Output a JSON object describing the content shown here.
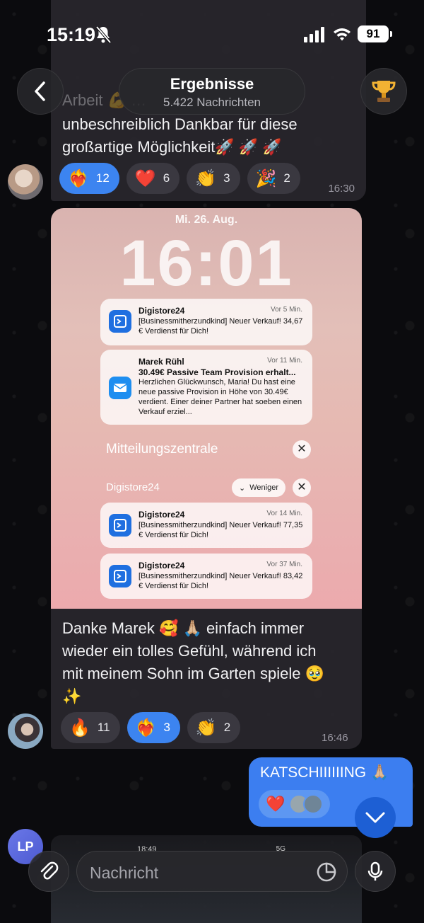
{
  "status_bar": {
    "time": "15:19",
    "battery": "91"
  },
  "header": {
    "title": "Ergebnisse",
    "subtitle": "5.422 Nachrichten"
  },
  "messages": [
    {
      "text_lines": [
        "Arbeit 💪 …",
        "unbeschreiblich Dankbar für diese",
        "großartige Möglichkeit🚀 🚀 🚀"
      ],
      "reactions": [
        {
          "emoji": "❤️‍🔥",
          "count": "12",
          "active": true
        },
        {
          "emoji": "❤️",
          "count": "6",
          "active": false
        },
        {
          "emoji": "👏",
          "count": "3",
          "active": false
        },
        {
          "emoji": "🎉",
          "count": "2",
          "active": false
        }
      ],
      "time": "16:30"
    },
    {
      "screenshot": {
        "date": "Mi. 26. Aug.",
        "clock": "16:01",
        "notifications": [
          {
            "app": "Digistore24",
            "when": "Vor 5 Min.",
            "title": "",
            "body": "[Businessmitherzundkind] Neuer Verkauf! 34,67 € Verdienst für Dich!"
          },
          {
            "app": "Marek Rühl",
            "when": "Vor 11 Min.",
            "title": "30.49€ Passive Team Provision erhalt...",
            "body": "Herzlichen Glückwunsch, Maria! Du hast eine neue passive Provision in Höhe von 30.49€ verdient. Einer deiner Partner hat soeben einen Verkauf erziel..."
          },
          {
            "app": "Digistore24",
            "when": "Vor 14 Min.",
            "title": "",
            "body": "[Businessmitherzundkind] Neuer Verkauf! 77,35 € Verdienst für Dich!"
          },
          {
            "app": "Digistore24",
            "when": "Vor 37 Min.",
            "title": "",
            "body": "[Businessmitherzundkind] Neuer Verkauf! 83,42 € Verdienst für Dich!"
          }
        ],
        "notification_center": "Mitteilungszentrale",
        "group_label": "Digistore24",
        "less_label": "Weniger"
      },
      "text_lines": [
        "Danke Marek 🥰 🙏🏼 einfach immer",
        "wieder ein tolles Gefühl, während ich",
        "mit meinem Sohn im Garten spiele 🥹",
        "✨"
      ],
      "reactions": [
        {
          "emoji": "🔥",
          "count": "11",
          "active": false
        },
        {
          "emoji": "❤️‍🔥",
          "count": "3",
          "active": true
        },
        {
          "emoji": "👏",
          "count": "2",
          "active": false
        }
      ],
      "time": "16:46"
    }
  ],
  "outgoing": {
    "text": "KATSCHIIIIIING 🙏🏼",
    "reaction": "❤️"
  },
  "lp_initials": "LP",
  "preview": {
    "time": "18:49",
    "net": "5G"
  },
  "composer": {
    "placeholder": "Nachricht"
  },
  "colors": {
    "accent": "#3c84f0",
    "bubble": "#28262c"
  }
}
